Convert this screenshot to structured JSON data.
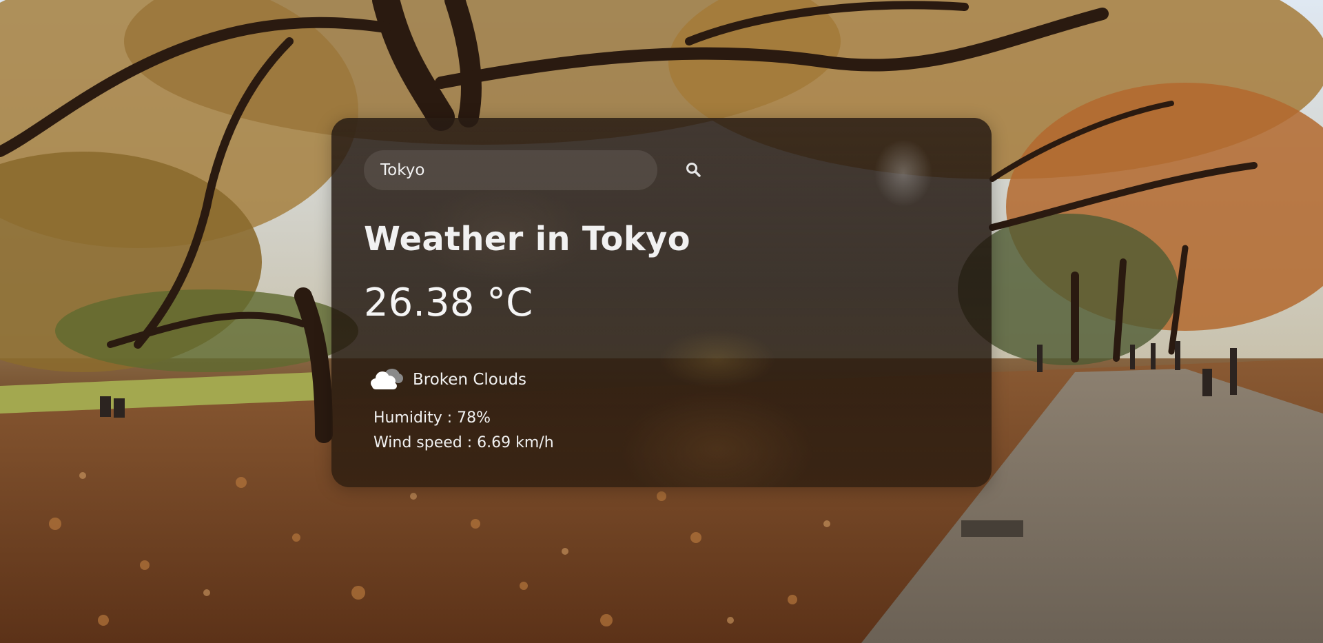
{
  "search": {
    "value": "Tokyo",
    "button_icon": "search-icon"
  },
  "weather": {
    "title": "Weather in Tokyo",
    "temperature": "26.38 °C",
    "condition_icon": "cloud-icon",
    "description": "Broken Clouds",
    "humidity": "Humidity : 78%",
    "wind_speed": "Wind speed : 6.69 km/h"
  },
  "colors": {
    "card_background": "#1c120c",
    "text": "#f1f1f1"
  }
}
